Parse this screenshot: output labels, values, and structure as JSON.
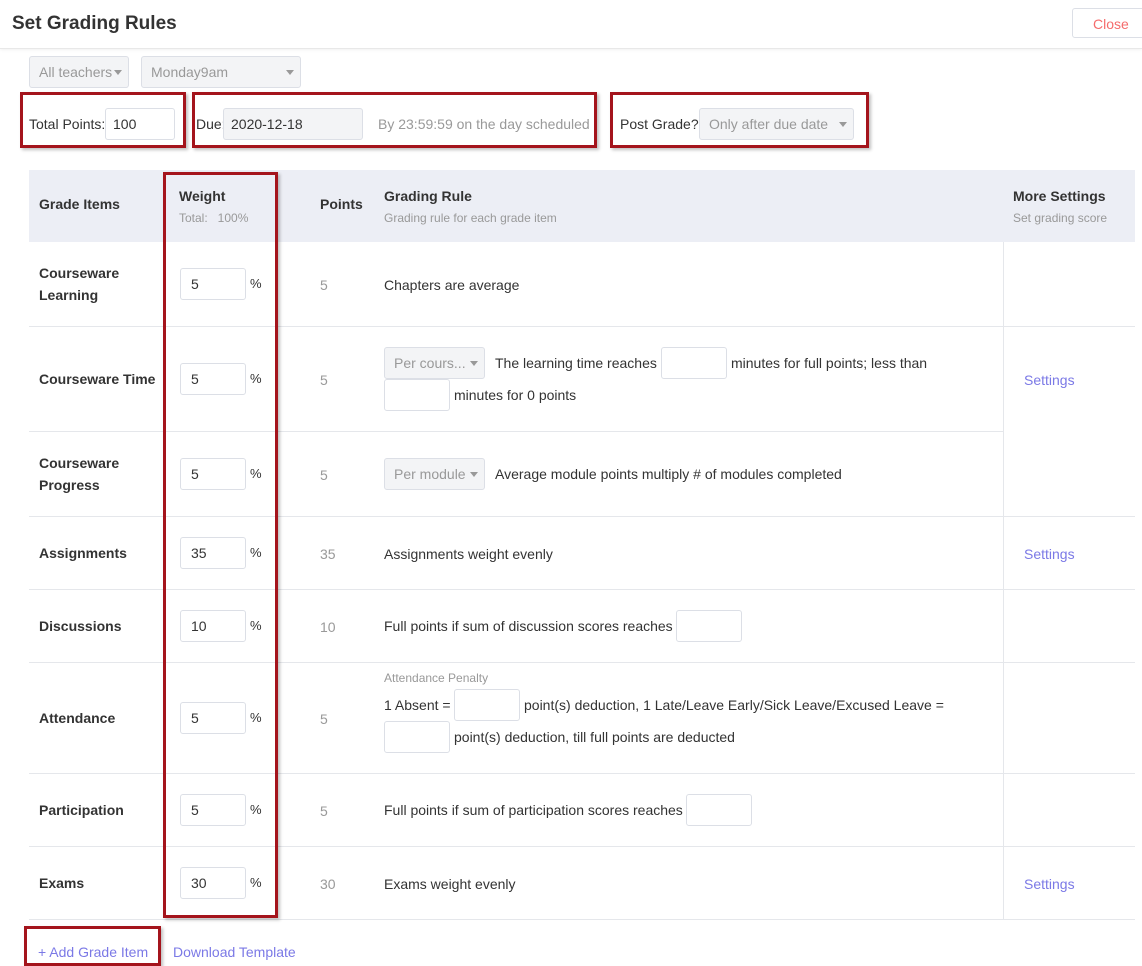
{
  "header": {
    "title": "Set Grading Rules",
    "close_label": "Close"
  },
  "filters": {
    "teacher": "All teachers",
    "class": "Monday9am"
  },
  "settings": {
    "total_points_label": "Total Points:",
    "total_points_value": "100",
    "due_label": "Due:",
    "due_value": "2020-12-18",
    "due_note": "By 23:59:59 on the day scheduled",
    "post_grade_label": "Post Grade?",
    "post_grade_value": "Only after due date"
  },
  "table": {
    "headers": {
      "grade_items": "Grade Items",
      "weight": "Weight",
      "weight_total": "Total:   100%",
      "points": "Points",
      "grading_rule": "Grading Rule",
      "grading_rule_sub": "Grading rule for each grade item",
      "more_settings": "More Settings",
      "more_settings_sub": "Set grading score"
    },
    "percent_sign": "%",
    "rows": [
      {
        "name": "Courseware Learning",
        "weight": "5",
        "points": "5",
        "rule": "Chapters are average"
      },
      {
        "name": "Courseware Time",
        "weight": "5",
        "points": "5",
        "select": "Per cours...",
        "rule_a": "The learning time reaches",
        "rule_b": "minutes for full points; less than",
        "rule_c": "minutes for 0 points",
        "settings": "Settings"
      },
      {
        "name": "Courseware Progress",
        "weight": "5",
        "points": "5",
        "select": "Per module",
        "rule": "Average module points multiply # of modules completed"
      },
      {
        "name": "Assignments",
        "weight": "35",
        "points": "35",
        "rule": "Assignments weight evenly",
        "settings": "Settings"
      },
      {
        "name": "Discussions",
        "weight": "10",
        "points": "10",
        "rule": "Full points if sum of discussion scores reaches"
      },
      {
        "name": "Attendance",
        "weight": "5",
        "points": "5",
        "penalty_label": "Attendance Penalty",
        "rule_a": "1 Absent =",
        "rule_b": "point(s) deduction, 1 Late/Leave Early/Sick Leave/Excused Leave =",
        "rule_c": "point(s) deduction, till full points are deducted"
      },
      {
        "name": "Participation",
        "weight": "5",
        "points": "5",
        "rule": "Full points if sum of participation scores reaches"
      },
      {
        "name": "Exams",
        "weight": "30",
        "points": "30",
        "rule": "Exams weight evenly",
        "settings": "Settings"
      }
    ]
  },
  "footer": {
    "add_item": "+ Add Grade Item",
    "download": "Download Template"
  },
  "colors": {
    "highlight": "#a4141c",
    "link": "#7b79e6",
    "close": "#f56c6c",
    "header_bg": "#eceef5"
  }
}
